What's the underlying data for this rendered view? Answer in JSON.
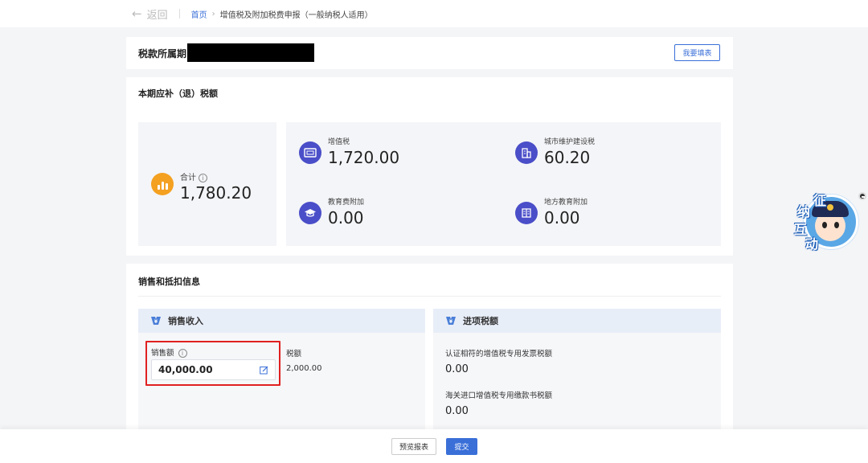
{
  "topbar": {
    "back_label": "返回",
    "breadcrumb": {
      "home": "首页",
      "separator": "›",
      "current": "增值税及附加税费申报（一般纳税人适用）"
    }
  },
  "period_card": {
    "title": "税款所属期",
    "fill_button": "我要填表"
  },
  "tax_card": {
    "title": "本期应补（退）税额",
    "total": {
      "label": "合计",
      "value": "1,780.20"
    },
    "items": [
      {
        "label": "增值税",
        "value": "1,720.00",
        "icon": "invoice-icon"
      },
      {
        "label": "城市维护建设税",
        "value": "60.20",
        "icon": "building-icon"
      },
      {
        "label": "教育费附加",
        "value": "0.00",
        "icon": "graduation-cap-icon"
      },
      {
        "label": "地方教育附加",
        "value": "0.00",
        "icon": "book-icon"
      }
    ]
  },
  "sales_card": {
    "title": "销售和抵扣信息",
    "sales_panel": {
      "header": "销售收入",
      "sales_label": "销售额",
      "sales_value": "40,000.00",
      "tax_label": "税额",
      "tax_value": "2,000.00"
    },
    "input_panel": {
      "header": "进项税额",
      "row1_label": "认证相符的增值税专用发票税额",
      "row1_value": "0.00",
      "row2_label": "海关进口增值税专用缴款书税额",
      "row2_value": "0.00"
    }
  },
  "footer": {
    "preview_button": "预览报表",
    "submit_button": "提交"
  },
  "mascot": {
    "chars": [
      "征",
      "纳",
      "互",
      "动"
    ]
  },
  "colors": {
    "accent": "#3a6fd8",
    "tax_icon": "#4a4ec8",
    "total_icon": "#f4a020",
    "highlight": "#e02020"
  }
}
